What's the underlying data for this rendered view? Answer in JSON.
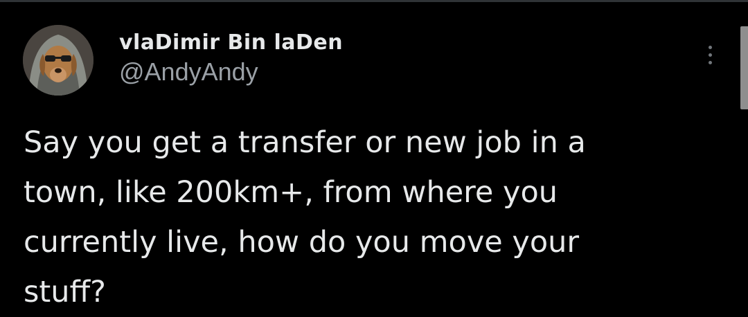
{
  "tweet": {
    "author": {
      "display_name": "vlaDimir Bin laDen",
      "handle": "@AndyAndy",
      "avatar_icon": "dog-in-hoodie-avatar"
    },
    "text_lines": [
      "Say you get a transfer or new job in a",
      "town, like 200km+, from where you",
      "currently live, how do you move your",
      "stuff?"
    ],
    "more_icon": "vertical-ellipsis-icon"
  },
  "colors": {
    "background": "#000000",
    "text_primary": "#e7e9ea",
    "text_secondary": "#9aa0a6",
    "icon_muted": "#71767b"
  }
}
